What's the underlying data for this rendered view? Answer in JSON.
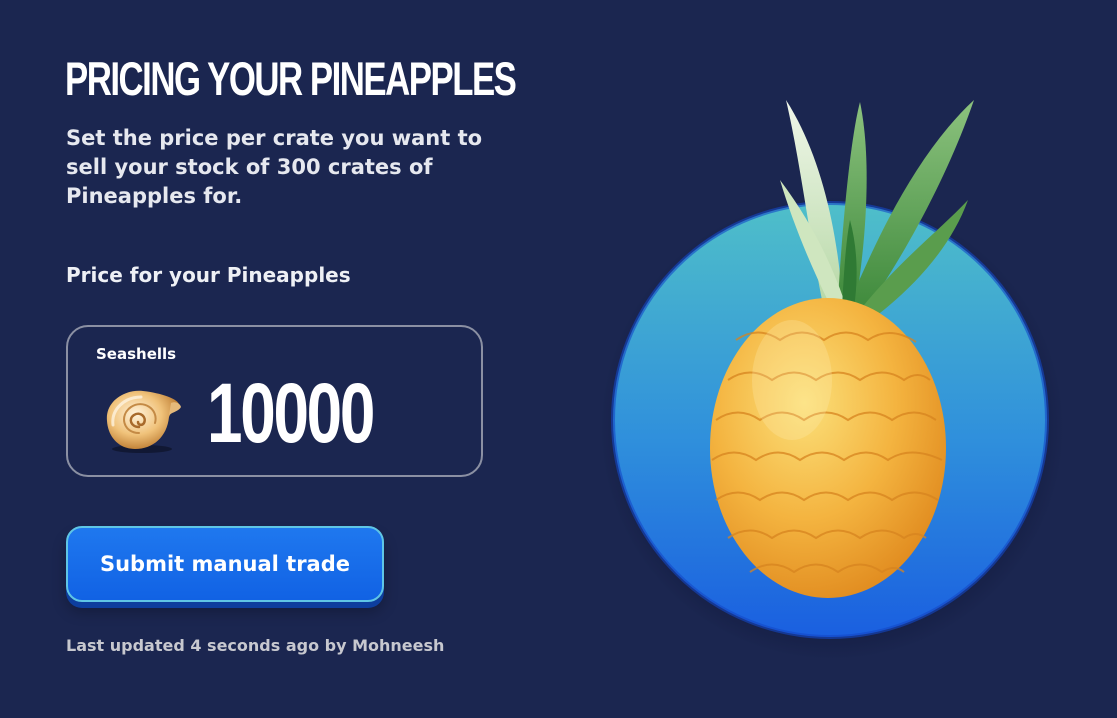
{
  "header": {
    "title": "PRICING YOUR PINEAPPLES",
    "description": "Set the price per crate you want to sell your stock of 300 crates of Pineapples for."
  },
  "price_section": {
    "label": "Price for your Pineapples",
    "currency_label": "Seashells",
    "currency_icon": "seashell-icon",
    "value": "10000"
  },
  "actions": {
    "submit_label": "Submit manual trade"
  },
  "footer": {
    "last_updated": "Last updated 4 seconds ago by Mohneesh"
  },
  "illustration": {
    "icon": "pineapple-icon"
  },
  "colors": {
    "background": "#1b2650",
    "button": "#1a6cea",
    "button_border": "#5fc6e6",
    "circle_top": "#4fbfc9",
    "circle_bottom": "#1a5fe0"
  }
}
